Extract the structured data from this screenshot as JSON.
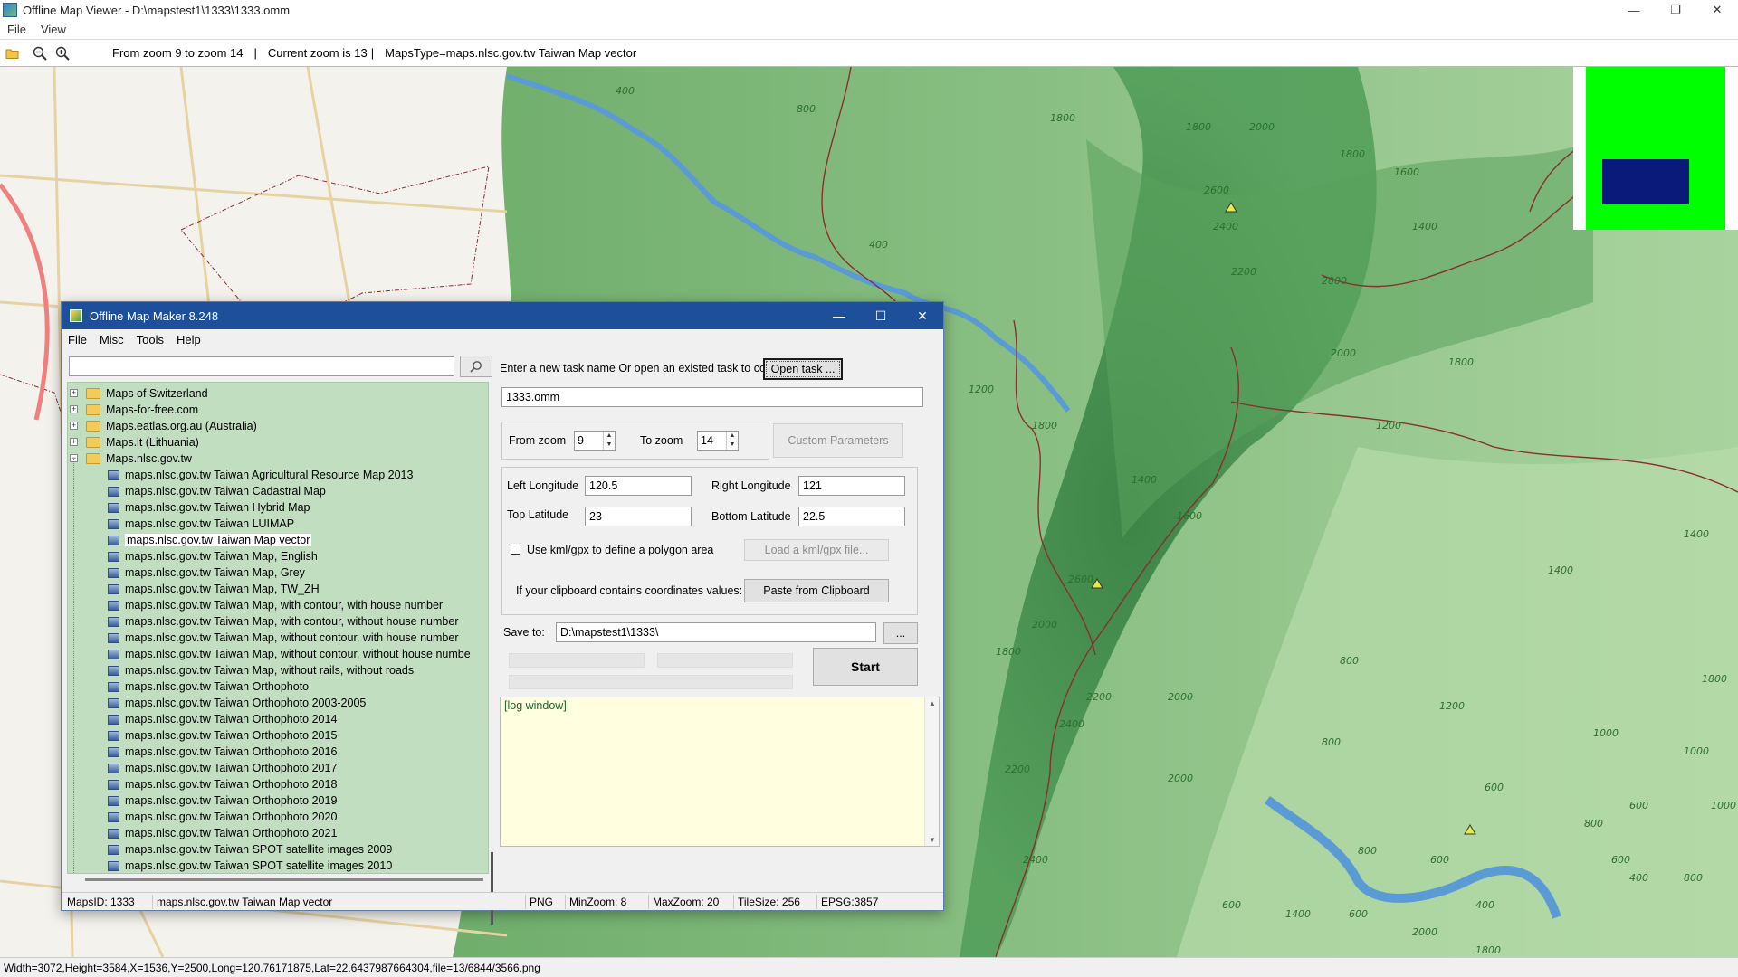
{
  "viewer": {
    "title": "Offline Map Viewer - D:\\mapstest1\\1333\\1333.omm",
    "window_controls": {
      "minimize": "—",
      "restore": "❐",
      "close": "✕"
    },
    "menu": [
      "File",
      "View"
    ],
    "toolbar": {
      "zoom_range": "From zoom 9 to zoom 14",
      "current_zoom": "Current zoom is 13",
      "maps_type": "MapsType=maps.nlsc.gov.tw Taiwan Map vector",
      "separator": "|"
    },
    "status": "Width=3072,Height=3584,X=1536,Y=2500,Long=120.76171875,Lat=22.6437987664304,file=13/6844/3566.png"
  },
  "map": {
    "contours": [
      "400",
      "800",
      "1800",
      "1800",
      "2000",
      "1800",
      "2600",
      "2400",
      "2200",
      "2000",
      "1600",
      "1400",
      "400",
      "1200",
      "1800",
      "1400",
      "1600",
      "2000",
      "1800",
      "1200",
      "1400",
      "1400",
      "2600",
      "2000",
      "2000",
      "1800",
      "2400",
      "2200",
      "2000",
      "800",
      "1200",
      "1000",
      "800",
      "600",
      "1000",
      "600",
      "800",
      "600",
      "400",
      "1400",
      "2000",
      "1800",
      "1400",
      "600",
      "1800",
      "2200",
      "2400",
      "800",
      "600",
      "400",
      "800",
      "600",
      "1000"
    ],
    "peak_markers": 3,
    "colors": {
      "forest": "#3e8f48",
      "river": "#5b9bd5",
      "road": "#8b2e2e",
      "urban": "#f4f2ec"
    }
  },
  "overview": {
    "bg_color": "#00ff00",
    "viewport_color": "#0a1a7a"
  },
  "maker": {
    "title": "Offline Map Maker 8.248",
    "window_controls": {
      "minimize": "—",
      "maximize": "☐",
      "close": "✕"
    },
    "menu": [
      "File",
      "Misc",
      "Tools",
      "Help"
    ],
    "search": {
      "value": "",
      "icon": "search-icon"
    },
    "tree": [
      {
        "label": "Maps of Switzerland",
        "level": 0,
        "type": "folder",
        "expander": "+"
      },
      {
        "label": "Maps-for-free.com",
        "level": 0,
        "type": "folder",
        "expander": "+"
      },
      {
        "label": "Maps.eatlas.org.au (Australia)",
        "level": 0,
        "type": "folder",
        "expander": "+"
      },
      {
        "label": "Maps.lt (Lithuania)",
        "level": 0,
        "type": "folder",
        "expander": "+"
      },
      {
        "label": "Maps.nlsc.gov.tw",
        "level": 0,
        "type": "folder",
        "expander": "−"
      },
      {
        "label": "maps.nlsc.gov.tw Taiwan Agricultural Resource Map 2013",
        "level": 1,
        "type": "map"
      },
      {
        "label": "maps.nlsc.gov.tw Taiwan Cadastral Map",
        "level": 1,
        "type": "map"
      },
      {
        "label": "maps.nlsc.gov.tw Taiwan Hybrid Map",
        "level": 1,
        "type": "map"
      },
      {
        "label": "maps.nlsc.gov.tw Taiwan LUIMAP",
        "level": 1,
        "type": "map"
      },
      {
        "label": "maps.nlsc.gov.tw Taiwan Map vector",
        "level": 1,
        "type": "map",
        "selected": true
      },
      {
        "label": "maps.nlsc.gov.tw Taiwan Map, English",
        "level": 1,
        "type": "map"
      },
      {
        "label": "maps.nlsc.gov.tw Taiwan Map, Grey",
        "level": 1,
        "type": "map"
      },
      {
        "label": "maps.nlsc.gov.tw Taiwan Map, TW_ZH",
        "level": 1,
        "type": "map"
      },
      {
        "label": "maps.nlsc.gov.tw Taiwan Map, with contour, with house number",
        "level": 1,
        "type": "map"
      },
      {
        "label": "maps.nlsc.gov.tw Taiwan Map, with contour, without house number",
        "level": 1,
        "type": "map"
      },
      {
        "label": "maps.nlsc.gov.tw Taiwan Map, without contour, with house number",
        "level": 1,
        "type": "map"
      },
      {
        "label": "maps.nlsc.gov.tw Taiwan Map, without contour, without house numbe",
        "level": 1,
        "type": "map"
      },
      {
        "label": "maps.nlsc.gov.tw Taiwan Map, without rails, without roads",
        "level": 1,
        "type": "map"
      },
      {
        "label": "maps.nlsc.gov.tw Taiwan Orthophoto",
        "level": 1,
        "type": "map"
      },
      {
        "label": "maps.nlsc.gov.tw Taiwan Orthophoto 2003-2005",
        "level": 1,
        "type": "map"
      },
      {
        "label": "maps.nlsc.gov.tw Taiwan Orthophoto 2014",
        "level": 1,
        "type": "map"
      },
      {
        "label": "maps.nlsc.gov.tw Taiwan Orthophoto 2015",
        "level": 1,
        "type": "map"
      },
      {
        "label": "maps.nlsc.gov.tw Taiwan Orthophoto 2016",
        "level": 1,
        "type": "map"
      },
      {
        "label": "maps.nlsc.gov.tw Taiwan Orthophoto 2017",
        "level": 1,
        "type": "map"
      },
      {
        "label": "maps.nlsc.gov.tw Taiwan Orthophoto 2018",
        "level": 1,
        "type": "map"
      },
      {
        "label": "maps.nlsc.gov.tw Taiwan Orthophoto 2019",
        "level": 1,
        "type": "map"
      },
      {
        "label": "maps.nlsc.gov.tw Taiwan Orthophoto 2020",
        "level": 1,
        "type": "map"
      },
      {
        "label": "maps.nlsc.gov.tw Taiwan Orthophoto 2021",
        "level": 1,
        "type": "map"
      },
      {
        "label": "maps.nlsc.gov.tw Taiwan SPOT satellite images 2009",
        "level": 1,
        "type": "map"
      },
      {
        "label": "maps.nlsc.gov.tw Taiwan SPOT satellite images 2010",
        "level": 1,
        "type": "map"
      }
    ],
    "task": {
      "prompt": "Enter a new task name Or open an existed task to continue:",
      "open_button": "Open task ...",
      "name_value": "1333.omm"
    },
    "zoom": {
      "from_label": "From zoom",
      "from_value": "9",
      "to_label": "To zoom",
      "to_value": "14",
      "custom_button": "Custom Parameters"
    },
    "coords": {
      "left_lon_label": "Left Longitude",
      "left_lon_value": "120.5",
      "right_lon_label": "Right Longitude",
      "right_lon_value": "121",
      "top_lat_label": "Top Latitude",
      "top_lat_value": "23",
      "bottom_lat_label": "Bottom Latitude",
      "bottom_lat_value": "22.5",
      "kml_checkbox_label": "Use kml/gpx to define a polygon area",
      "kml_checked": false,
      "load_kml_button": "Load a kml/gpx file...",
      "clipboard_label": "If your clipboard contains coordinates values:",
      "paste_button": "Paste from Clipboard"
    },
    "save": {
      "label": "Save to:",
      "value": "D:\\mapstest1\\1333\\",
      "browse_button": "..."
    },
    "start_button": "Start",
    "log": {
      "text": "[log window]"
    },
    "status": {
      "maps_id": "MapsID: 1333",
      "map_name": "maps.nlsc.gov.tw Taiwan Map vector",
      "format": "PNG",
      "min_zoom": "MinZoom: 8",
      "max_zoom": "MaxZoom: 20",
      "tile_size": "TileSize: 256",
      "epsg": "EPSG:3857"
    }
  }
}
